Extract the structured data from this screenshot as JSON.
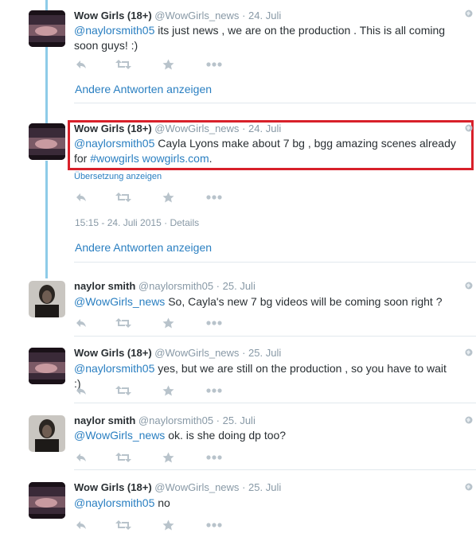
{
  "accounts": {
    "wowgirls": {
      "name": "Wow Girls (18+)",
      "handle": "@WowGirls_news"
    },
    "naylor": {
      "name": "naylor smith",
      "handle": "@naylorsmith05"
    }
  },
  "separator": "·",
  "icons": [
    "reply-icon",
    "retweet-icon",
    "favorite-icon",
    "more-icon",
    "globe-icon"
  ],
  "tweets": [
    {
      "time": "24. Juli",
      "mention": "@naylorsmith05",
      "text": " its just news , we are on the production . This is all coming soon guys! :)",
      "more_replies": "Andere Antworten anzeigen"
    },
    {
      "time": "24. Juli",
      "mention": "@naylorsmith05",
      "text": " Cayla Lyons make about 7 bg , bgg amazing scenes already for ",
      "hashtag": "#wowgirls",
      "url": "wowgirls.com",
      "end": ".",
      "translate": "Übersetzung anzeigen",
      "timestamp": "15:15 - 24. Juli 2015",
      "details": "Details",
      "more_replies": "Andere Antworten anzeigen"
    },
    {
      "time": "25. Juli",
      "mention": "@WowGirls_news",
      "text": " So, Cayla's new 7 bg videos will be coming soon right ?"
    },
    {
      "time": "25. Juli",
      "mention": "@naylorsmith05",
      "text": " yes, but we are still on the production , so you have to wait :)"
    },
    {
      "time": "25. Juli",
      "mention": "@WowGirls_news",
      "text": " ok. is she doing dp too?"
    },
    {
      "time": "25. Juli",
      "mention": "@naylorsmith05",
      "text": " no"
    }
  ],
  "colors": {
    "link": "#2a7fc1",
    "muted": "#8899a6",
    "thread_line": "#8ecbe8",
    "highlight_border": "#d8202a"
  }
}
